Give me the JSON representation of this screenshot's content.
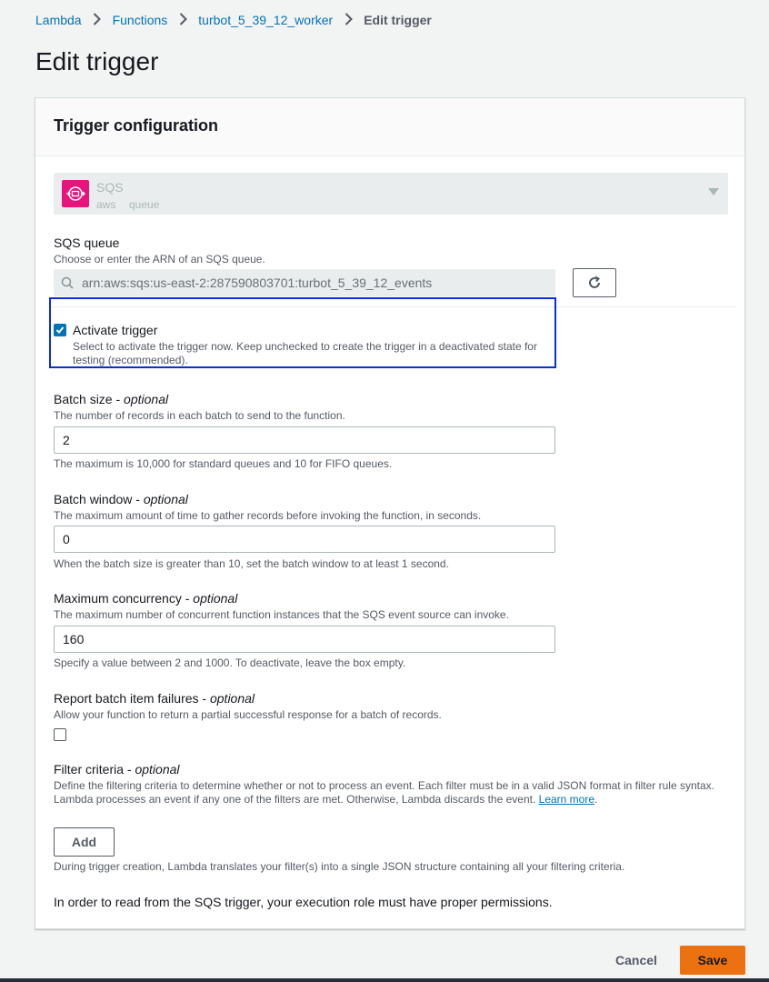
{
  "breadcrumb": {
    "items": [
      "Lambda",
      "Functions",
      "turbot_5_39_12_worker"
    ],
    "current": "Edit trigger"
  },
  "page_title": "Edit trigger",
  "panel": {
    "title": "Trigger configuration",
    "source": {
      "name": "SQS",
      "tags": [
        "aws",
        "queue"
      ],
      "logo_color": "#e7157b",
      "icon": "sqs-icon"
    },
    "sqs_queue": {
      "label": "SQS queue",
      "description": "Choose or enter the ARN of an SQS queue.",
      "value": "arn:aws:sqs:us-east-2:287590803701:turbot_5_39_12_events"
    },
    "activate_trigger": {
      "label": "Activate trigger",
      "checked": true,
      "description": "Select to activate the trigger now. Keep unchecked to create the trigger in a deactivated state for testing (recommended)."
    },
    "batch_size": {
      "label": "Batch size",
      "optional": "optional",
      "description": "The number of records in each batch to send to the function.",
      "value": "2",
      "hint": "The maximum is 10,000 for standard queues and 10 for FIFO queues."
    },
    "batch_window": {
      "label": "Batch window",
      "optional": "optional",
      "description": "The maximum amount of time to gather records before invoking the function, in seconds.",
      "value": "0",
      "hint": "When the batch size is greater than 10, set the batch window to at least 1 second."
    },
    "max_concurrency": {
      "label": "Maximum concurrency",
      "optional": "optional",
      "description": "The maximum number of concurrent function instances that the SQS event source can invoke.",
      "value": "160",
      "hint": "Specify a value between 2 and 1000. To deactivate, leave the box empty."
    },
    "report_failures": {
      "label": "Report batch item failures",
      "optional": "optional",
      "description": "Allow your function to return a partial successful response for a batch of records.",
      "checked": false
    },
    "filter_criteria": {
      "label": "Filter criteria",
      "optional": "optional",
      "description_1": "Define the filtering criteria to determine whether or not to process an event. Each filter must be in a valid JSON format in filter rule syntax.",
      "description_2": "Lambda processes an event if any one of the filters are met. Otherwise, Lambda discards the event.",
      "learn_more": "Learn more",
      "add_label": "Add",
      "hint": "During trigger creation, Lambda translates your filter(s) into a single JSON structure containing all your filtering criteria."
    },
    "permissions_note": "In order to read from the SQS trigger, your execution role must have proper permissions."
  },
  "footer": {
    "cancel_label": "Cancel",
    "save_label": "Save",
    "save_color": "#ec7211"
  }
}
